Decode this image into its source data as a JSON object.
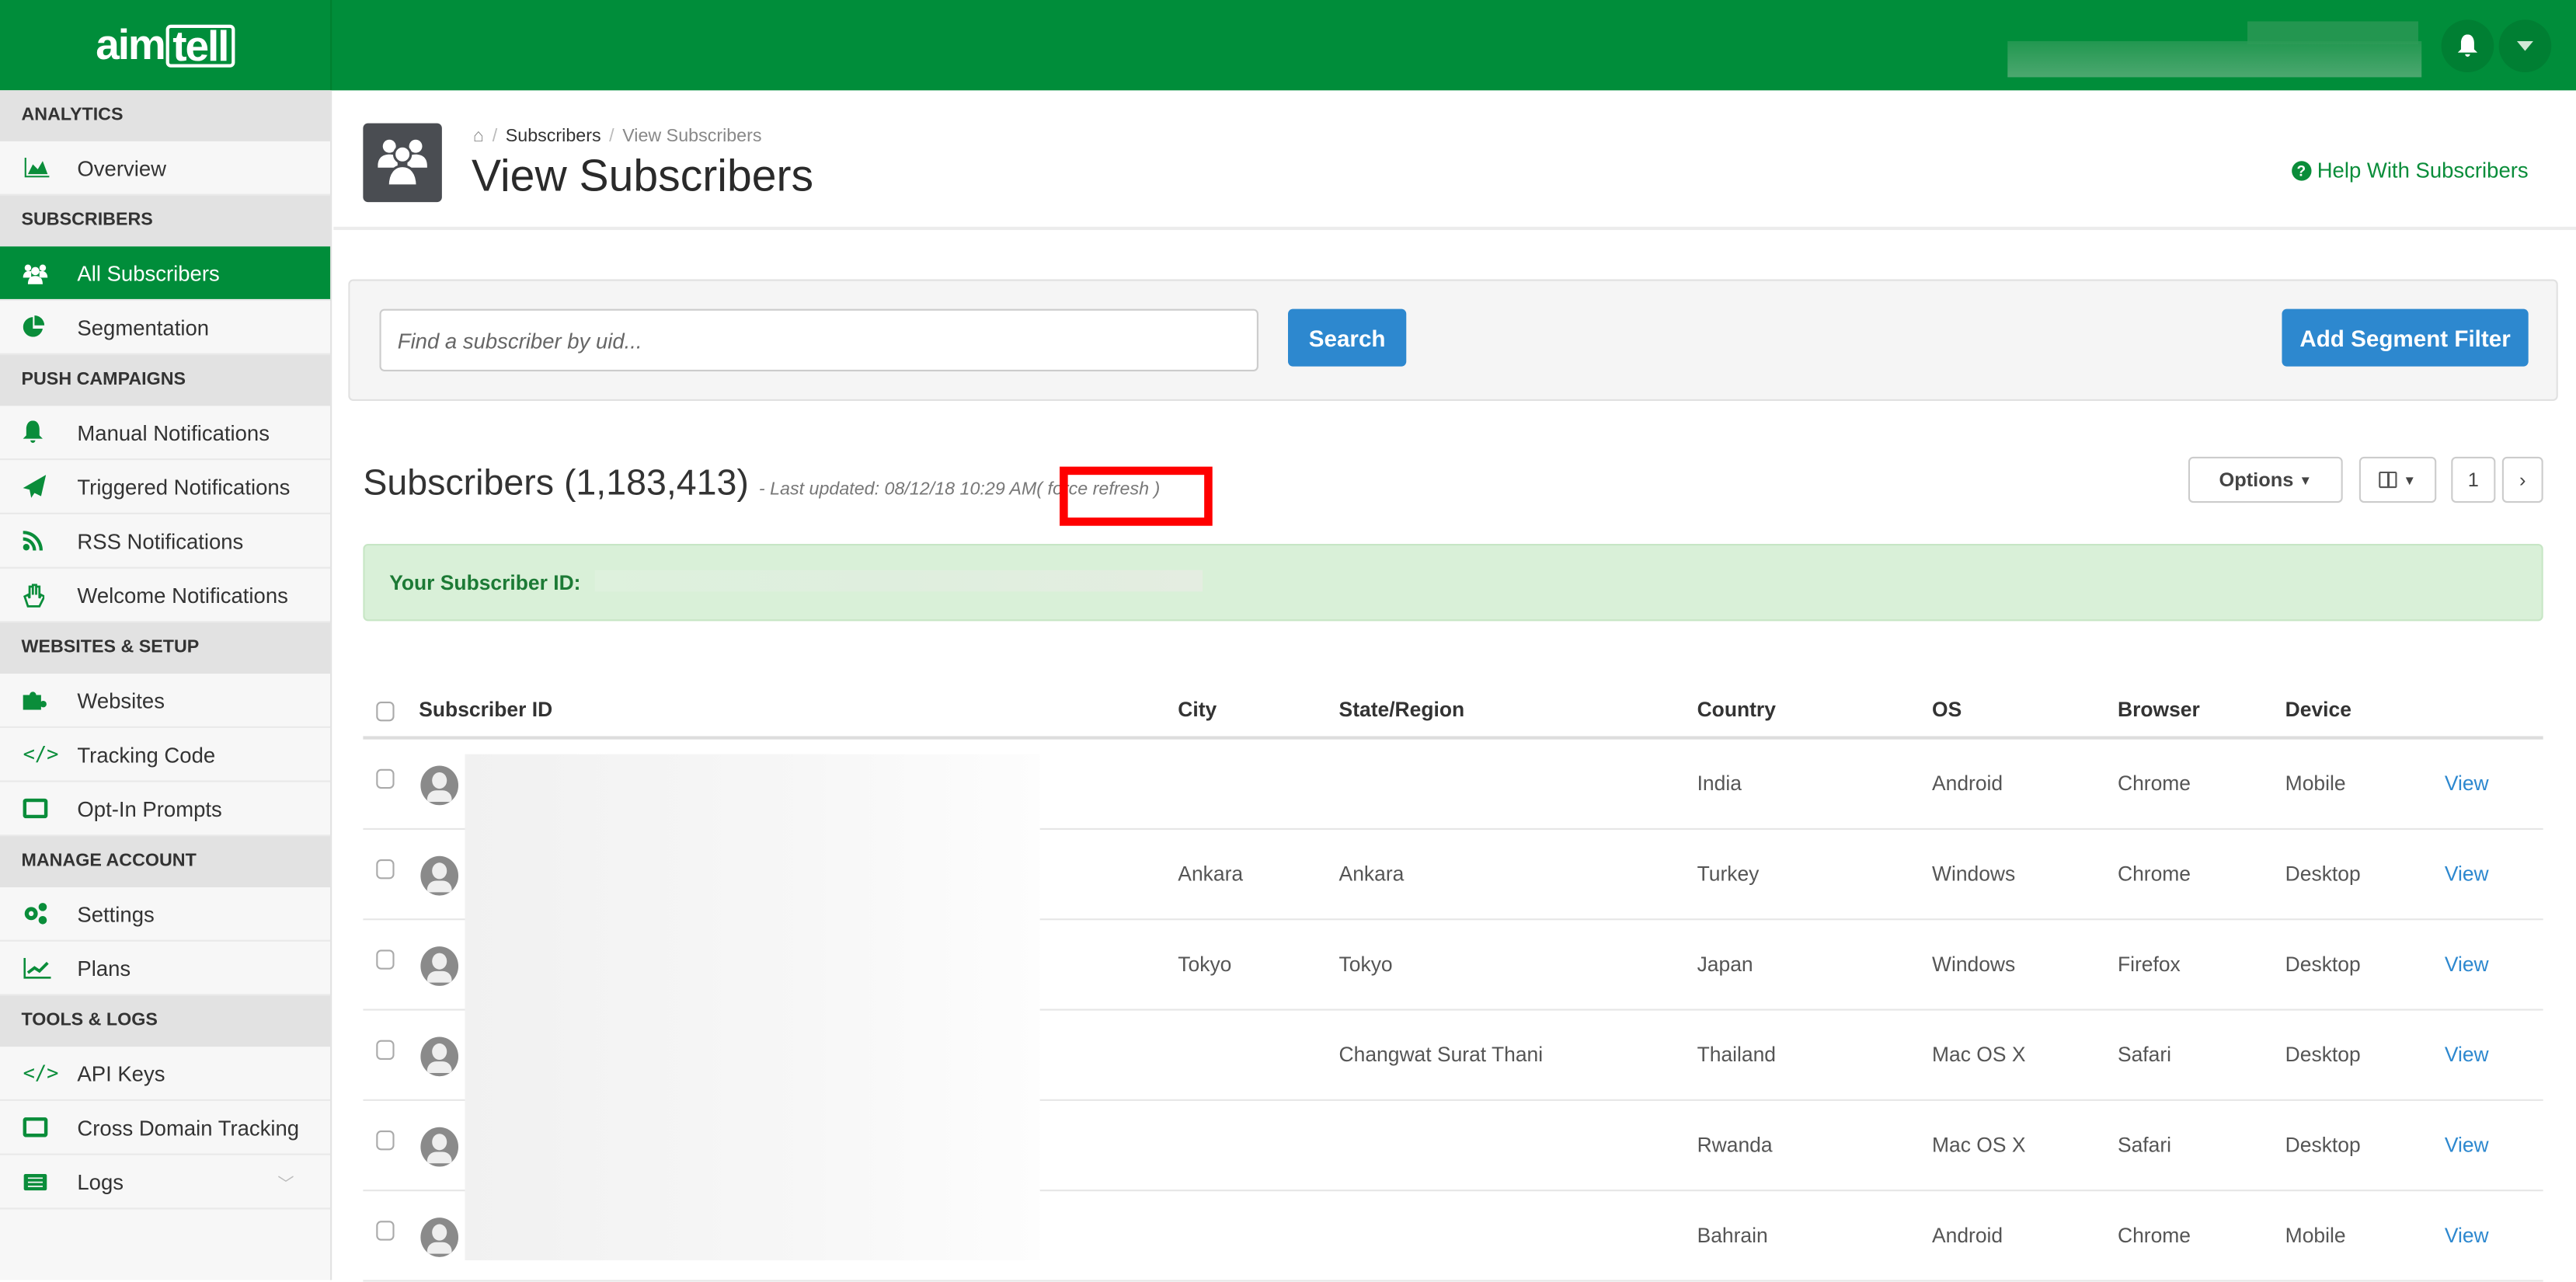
{
  "brand": {
    "logo_text_a": "aim",
    "logo_text_b": "tell"
  },
  "topbar": {
    "bell_icon": "bell-icon",
    "menu_icon": "caret-down-icon"
  },
  "sidebar": {
    "sections": [
      {
        "title": "ANALYTICS",
        "items": [
          {
            "label": "Overview",
            "icon": "area-chart-icon"
          }
        ]
      },
      {
        "title": "SUBSCRIBERS",
        "items": [
          {
            "label": "All Subscribers",
            "icon": "users-icon",
            "active": true
          },
          {
            "label": "Segmentation",
            "icon": "pie-chart-icon"
          }
        ]
      },
      {
        "title": "PUSH CAMPAIGNS",
        "items": [
          {
            "label": "Manual Notifications",
            "icon": "bell-icon"
          },
          {
            "label": "Triggered Notifications",
            "icon": "paper-plane-icon"
          },
          {
            "label": "RSS Notifications",
            "icon": "rss-icon"
          },
          {
            "label": "Welcome Notifications",
            "icon": "hand-wave-icon"
          }
        ]
      },
      {
        "title": "WEBSITES & SETUP",
        "items": [
          {
            "label": "Websites",
            "icon": "puzzle-icon"
          },
          {
            "label": "Tracking Code",
            "icon": "code-icon"
          },
          {
            "label": "Opt-In Prompts",
            "icon": "window-icon"
          }
        ]
      },
      {
        "title": "MANAGE ACCOUNT",
        "items": [
          {
            "label": "Settings",
            "icon": "gears-icon"
          },
          {
            "label": "Plans",
            "icon": "line-chart-icon"
          }
        ]
      },
      {
        "title": "TOOLS & LOGS",
        "items": [
          {
            "label": "API Keys",
            "icon": "code-icon"
          },
          {
            "label": "Cross Domain Tracking",
            "icon": "window-icon"
          },
          {
            "label": "Logs",
            "icon": "list-icon"
          }
        ]
      }
    ]
  },
  "header": {
    "breadcrumb": [
      "Subscribers",
      "View Subscribers"
    ],
    "title": "View Subscribers",
    "help_link": "Help With Subscribers"
  },
  "search": {
    "placeholder": "Find a subscriber by uid...",
    "value": "",
    "search_button": "Search",
    "segment_button": "Add Segment Filter"
  },
  "subscribers": {
    "title": "Subscribers (1,183,413)",
    "last_updated": "- Last updated: 08/12/18 10:29 AM",
    "force_refresh": "( force refresh )",
    "options_button": "Options",
    "page": "1",
    "next": "›"
  },
  "alert": {
    "label": "Your Subscriber ID:"
  },
  "table": {
    "columns": [
      "Subscriber ID",
      "City",
      "State/Region",
      "Country",
      "OS",
      "Browser",
      "Device"
    ],
    "rows": [
      {
        "city": "",
        "state": "",
        "country": "India",
        "os": "Android",
        "browser": "Chrome",
        "device": "Mobile",
        "action": "View"
      },
      {
        "city": "Ankara",
        "state": "Ankara",
        "country": "Turkey",
        "os": "Windows",
        "browser": "Chrome",
        "device": "Desktop",
        "action": "View"
      },
      {
        "city": "Tokyo",
        "state": "Tokyo",
        "country": "Japan",
        "os": "Windows",
        "browser": "Firefox",
        "device": "Desktop",
        "action": "View"
      },
      {
        "city": "",
        "state": "Changwat Surat Thani",
        "country": "Thailand",
        "os": "Mac OS X",
        "browser": "Safari",
        "device": "Desktop",
        "action": "View"
      },
      {
        "city": "",
        "state": "",
        "country": "Rwanda",
        "os": "Mac OS X",
        "browser": "Safari",
        "device": "Desktop",
        "action": "View"
      },
      {
        "city": "",
        "state": "",
        "country": "Bahrain",
        "os": "Android",
        "browser": "Chrome",
        "device": "Mobile",
        "action": "View"
      }
    ]
  },
  "colors": {
    "brand_green": "#008d3a",
    "button_blue": "#2d88cf",
    "alert_bg": "#d9f0d8",
    "highlight_red": "#ff0000"
  }
}
